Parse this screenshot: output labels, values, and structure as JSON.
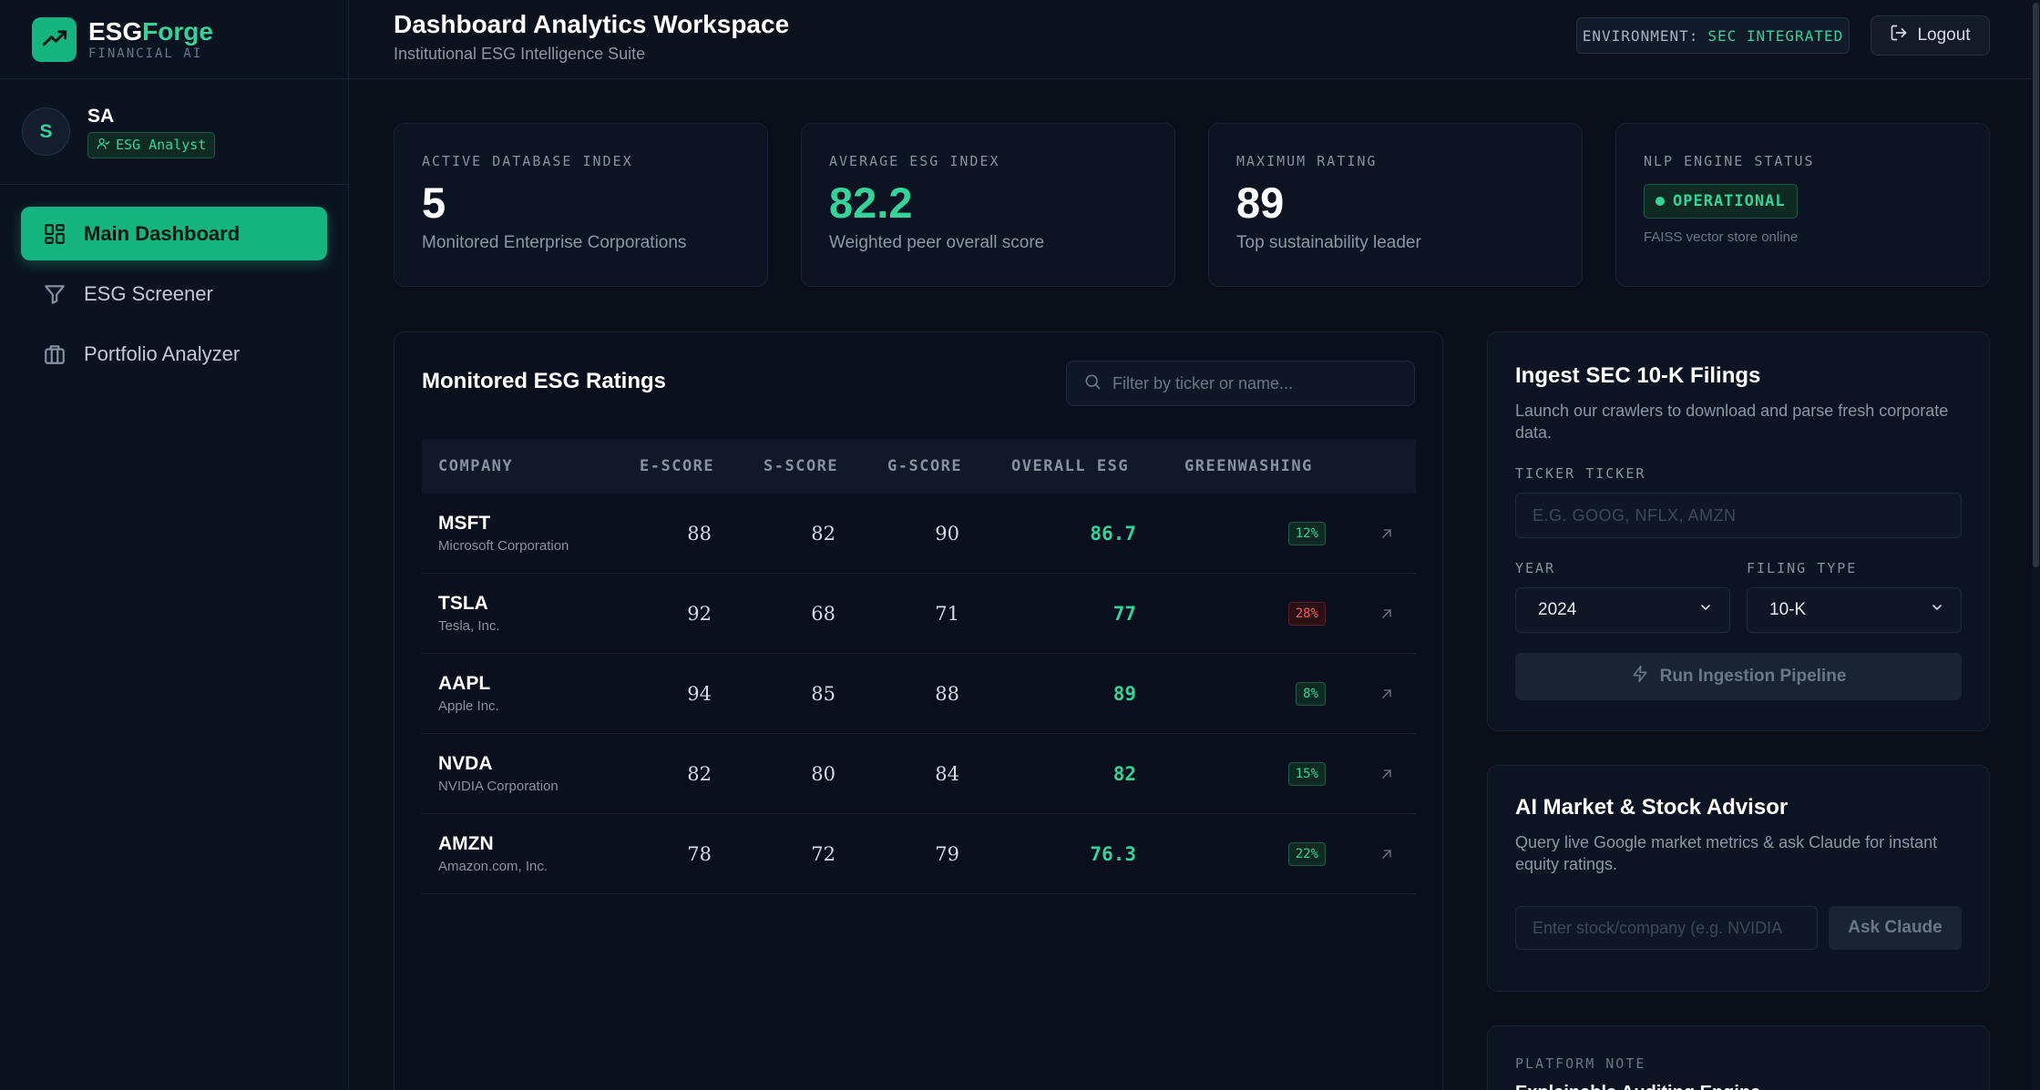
{
  "brand": {
    "name_part1": "ESG",
    "name_part2": "Forge",
    "subtitle": "FINANCIAL AI"
  },
  "user": {
    "initial": "S",
    "name": "SA",
    "role": "ESG Analyst"
  },
  "nav": [
    {
      "label": "Main Dashboard",
      "icon": "dashboard-icon",
      "active": true
    },
    {
      "label": "ESG Screener",
      "icon": "filter-icon",
      "active": false
    },
    {
      "label": "Portfolio Analyzer",
      "icon": "briefcase-icon",
      "active": false
    }
  ],
  "header": {
    "title": "Dashboard Analytics Workspace",
    "subtitle": "Institutional ESG Intelligence Suite",
    "env_label": "ENVIRONMENT:",
    "env_value": "SEC INTEGRATED",
    "logout_label": "Logout"
  },
  "stats": [
    {
      "label": "ACTIVE DATABASE INDEX",
      "value": "5",
      "desc": "Monitored Enterprise Corporations"
    },
    {
      "label": "AVERAGE ESG INDEX",
      "value": "82.2",
      "desc": "Weighted peer overall score"
    },
    {
      "label": "MAXIMUM RATING",
      "value": "89",
      "desc": "Top sustainability leader"
    },
    {
      "label": "NLP ENGINE STATUS",
      "badge": "OPERATIONAL",
      "desc": "FAISS vector store online"
    }
  ],
  "ratings": {
    "title": "Monitored ESG Ratings",
    "filter_placeholder": "Filter by ticker or name...",
    "columns": [
      "COMPANY",
      "E-SCORE",
      "S-SCORE",
      "G-SCORE",
      "OVERALL ESG",
      "GREENWASHING"
    ],
    "rows": [
      {
        "ticker": "MSFT",
        "name": "Microsoft Corporation",
        "e": "88",
        "s": "82",
        "g": "90",
        "overall": "86.7",
        "greenwashing": "12%"
      },
      {
        "ticker": "TSLA",
        "name": "Tesla, Inc.",
        "e": "92",
        "s": "68",
        "g": "71",
        "overall": "77",
        "greenwashing": "28%"
      },
      {
        "ticker": "AAPL",
        "name": "Apple Inc.",
        "e": "94",
        "s": "85",
        "g": "88",
        "overall": "89",
        "greenwashing": "8%"
      },
      {
        "ticker": "NVDA",
        "name": "NVIDIA Corporation",
        "e": "82",
        "s": "80",
        "g": "84",
        "overall": "82",
        "greenwashing": "15%"
      },
      {
        "ticker": "AMZN",
        "name": "Amazon.com, Inc.",
        "e": "78",
        "s": "72",
        "g": "79",
        "overall": "76.3",
        "greenwashing": "22%"
      }
    ]
  },
  "ingest": {
    "title": "Ingest SEC 10-K Filings",
    "desc": "Launch our crawlers to download and parse fresh corporate data.",
    "ticker_label": "TICKER TICKER",
    "ticker_placeholder": "E.G. GOOG, NFLX, AMZN",
    "year_label": "YEAR",
    "year_value": "2024",
    "filing_label": "FILING TYPE",
    "filing_value": "10-K",
    "run_label": "Run Ingestion Pipeline"
  },
  "advisor": {
    "title": "AI Market & Stock Advisor",
    "desc": "Query live Google market metrics & ask Claude for instant equity ratings.",
    "input_placeholder": "Enter stock/company (e.g. NVIDIA",
    "ask_label": "Ask Claude"
  },
  "note": {
    "label": "PLATFORM NOTE",
    "title": "Explainable Auditing Engine"
  },
  "colors": {
    "accent": "#16b47e",
    "accent_text": "#35d39a",
    "danger": "#ef5a62",
    "background": "#0a0f1a"
  }
}
